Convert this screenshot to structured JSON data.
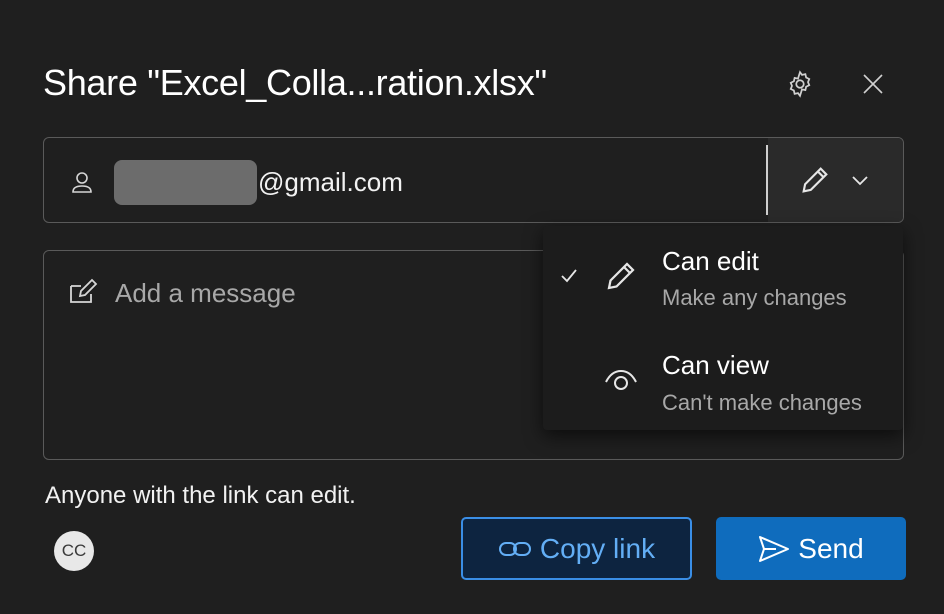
{
  "dialog": {
    "title": "Share \"Excel_Colla...ration.xlsx\"",
    "settings_icon": "gear-icon",
    "close_icon": "close-icon"
  },
  "recipient": {
    "email_suffix": "@gmail.com",
    "icon": "person-icon",
    "permission_icon": "pencil-icon"
  },
  "message": {
    "placeholder": "Add a message",
    "icon": "compose-icon"
  },
  "permission_menu": {
    "items": [
      {
        "title": "Can edit",
        "subtitle": "Make any changes",
        "icon": "pencil-icon",
        "selected": true
      },
      {
        "title": "Can view",
        "subtitle": "Can't make changes",
        "icon": "eye-icon",
        "selected": false
      }
    ]
  },
  "footer": {
    "link_note": "Anyone with the link can edit.",
    "avatar_initials": "CC",
    "copy_link_label": "Copy link",
    "send_label": "Send"
  },
  "colors": {
    "background": "#1f1f1f",
    "accent": "#0f6cbd",
    "accent_text": "#63aef5",
    "border": "#5a5a5a"
  }
}
